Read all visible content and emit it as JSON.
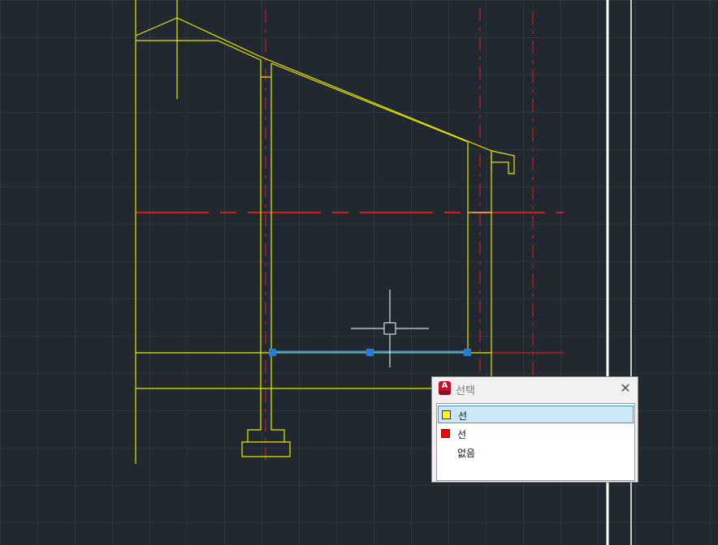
{
  "colors": {
    "background": "#212830",
    "grid": "#2c3640",
    "geometry": "#e6e600",
    "centerline": "#cc1f1f",
    "grip": "#1a7fe0",
    "selected_line": "#4aa8e6",
    "crosshair": "#ffffff"
  },
  "cursor_icon": "crosshair-pickbox-icon",
  "selection_popup": {
    "title": "선택",
    "app_icon": "autocad-icon",
    "close_icon": "close-icon",
    "items": [
      {
        "label": "선",
        "color": "#ffff00",
        "selected": true
      },
      {
        "label": "선",
        "color": "#ff0000",
        "selected": false
      },
      {
        "label": "없음",
        "color": "",
        "selected": false
      }
    ]
  }
}
